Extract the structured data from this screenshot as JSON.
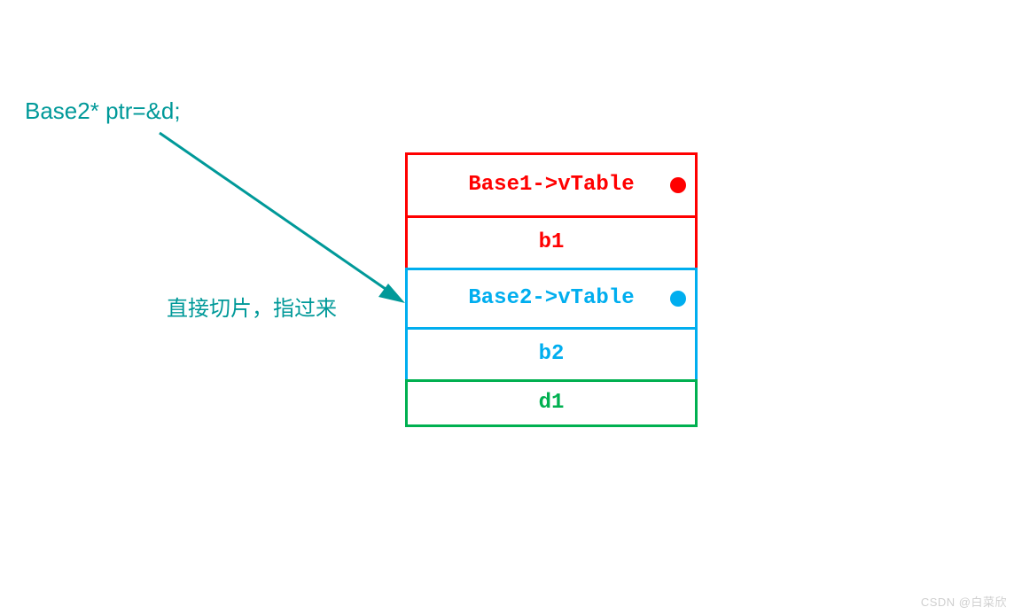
{
  "code": "Base2* ptr=&d;",
  "annotation": "直接切片，指过来",
  "rows": {
    "base1_vtable": "Base1->vTable",
    "b1": "b1",
    "base2_vtable": "Base2->vTable",
    "b2": "b2",
    "d1": "d1"
  },
  "colors": {
    "teal": "#009999",
    "red": "#ff0000",
    "blue": "#00aeef",
    "green": "#00b050"
  },
  "watermark": "CSDN @白菜欣"
}
